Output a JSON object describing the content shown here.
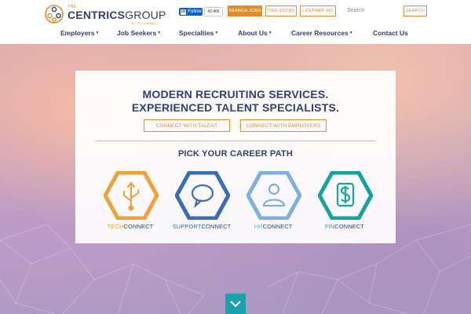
{
  "brand": {
    "the": "THE",
    "name_bold": "CENTRICS",
    "name_light": "GROUP",
    "tagline": "LET'S CONNECT"
  },
  "topbar": {
    "linkedin_in": "in",
    "linkedin_follow": "Follow",
    "linkedin_count": "42,466",
    "search_jobs": "SEARCH JOBS",
    "time_entry": "TIME ENTRY",
    "lifeprep": "LIFEPREP 360",
    "search_placeholder": "Search",
    "search_button": "SEARCH"
  },
  "nav": {
    "items": [
      {
        "label": "Employers",
        "caret": "▼"
      },
      {
        "label": "Job Seekers",
        "caret": "▼"
      },
      {
        "label": "Specialties",
        "caret": "▼"
      },
      {
        "label": "About Us",
        "caret": "▼"
      },
      {
        "label": "Career Resources",
        "caret": "▼"
      },
      {
        "label": "Contact Us",
        "caret": ""
      }
    ]
  },
  "hero": {
    "headline_1": "MODERN RECRUITING SERVICES.",
    "headline_2": "EXPERIENCED TALENT SPECIALISTS.",
    "connect_talent": "CONNECT WITH TALENT",
    "connect_employers": "CONNECT WITH EMPLOYERS",
    "pick_title": "PICK YOUR CAREER PATH",
    "paths": [
      {
        "prefix": "TECH",
        "suffix": "CONNECT",
        "color": "#f0a23a",
        "icon": "usb-icon"
      },
      {
        "prefix": "SUPPORT",
        "suffix": "CONNECT",
        "color": "#3c6cb4",
        "icon": "speech-bubble-icon"
      },
      {
        "prefix": "HR",
        "suffix": "CONNECT",
        "color": "#7fb0df",
        "icon": "person-icon"
      },
      {
        "prefix": "FIN",
        "suffix": "CONNECT",
        "color": "#1aa1a1",
        "icon": "dollar-icon"
      }
    ]
  },
  "colors": {
    "brand_navy": "#2f4271",
    "brand_orange": "#e38d2a",
    "scroll_teal": "#1aa1ab"
  }
}
